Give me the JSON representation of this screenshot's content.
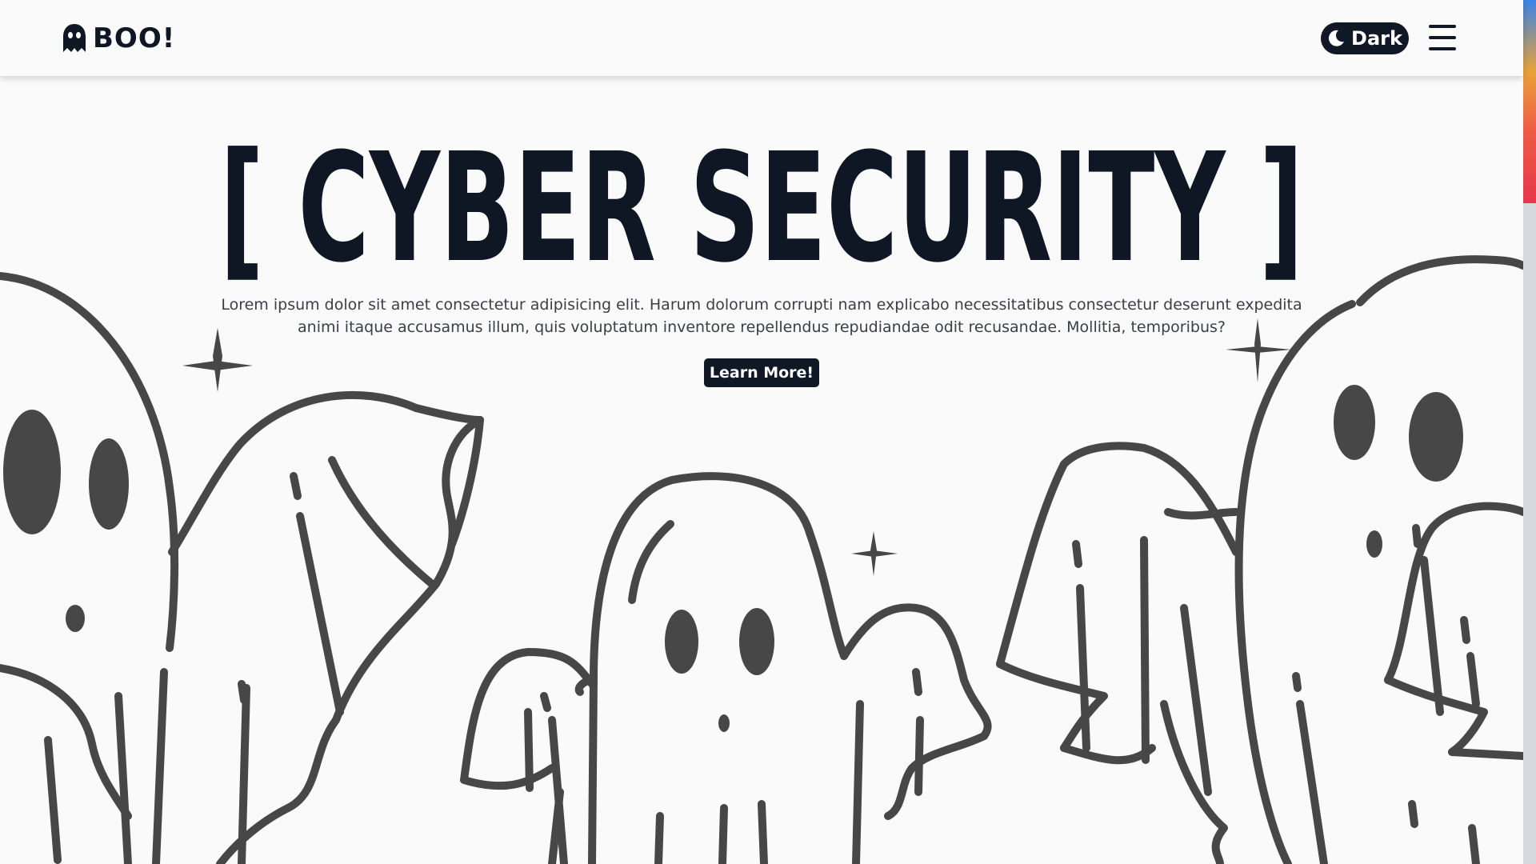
{
  "brand": {
    "name": "BOO!",
    "logo_icon": "ghost-icon"
  },
  "header": {
    "theme_toggle_label": "Dark",
    "theme_toggle_icon": "moon-icon",
    "menu_icon": "hamburger-menu-icon"
  },
  "hero": {
    "title": "[ CYBER SECURITY ]",
    "description": "Lorem ipsum dolor sit amet consectetur adipisicing elit. Harum dolorum corrupti nam explicabo necessitatibus consectetur deserunt expedita animi itaque accusamus illum, quis voluptatum inventore repellendus repudiandae odit recusandae. Mollitia, temporibus?",
    "cta_label": "Learn More!",
    "illustration": "ghost-line-art-illustration"
  },
  "colors": {
    "text_dark": "#0f1724",
    "background": "#fafafa",
    "line_art": "#474747"
  }
}
